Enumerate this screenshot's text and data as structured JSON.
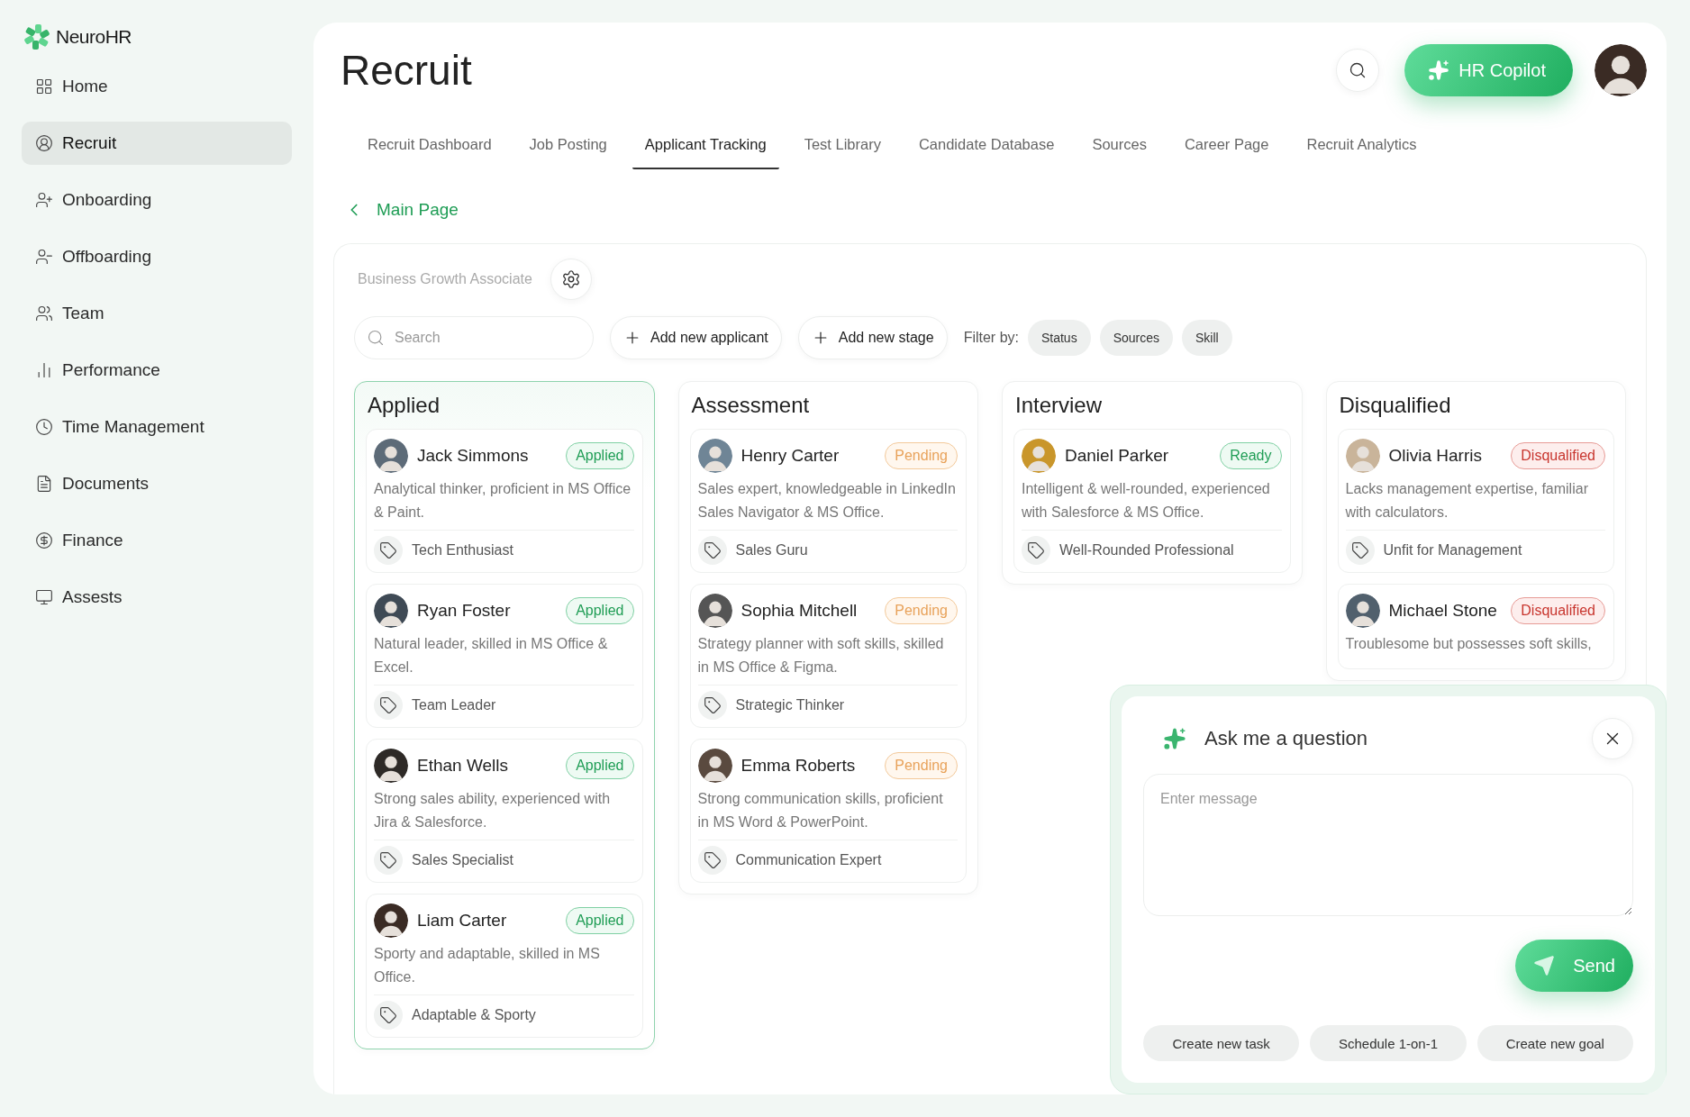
{
  "brand": "NeuroHR",
  "sidebar": {
    "items": [
      {
        "label": "Home",
        "selected": false
      },
      {
        "label": "Recruit",
        "selected": true
      },
      {
        "label": "Onboarding",
        "selected": false
      },
      {
        "label": "Offboarding",
        "selected": false
      },
      {
        "label": "Team",
        "selected": false
      },
      {
        "label": "Performance",
        "selected": false
      },
      {
        "label": "Time Management",
        "selected": false
      },
      {
        "label": "Documents",
        "selected": false
      },
      {
        "label": "Finance",
        "selected": false
      },
      {
        "label": "Assests",
        "selected": false
      }
    ]
  },
  "page": {
    "title": "Recruit",
    "copilot": "HR Copilot"
  },
  "tabs": [
    {
      "label": "Recruit Dashboard",
      "selected": false
    },
    {
      "label": "Job Posting",
      "selected": false
    },
    {
      "label": "Applicant Tracking",
      "selected": true
    },
    {
      "label": "Test Library",
      "selected": false
    },
    {
      "label": "Candidate Database",
      "selected": false
    },
    {
      "label": "Sources",
      "selected": false
    },
    {
      "label": "Career Page",
      "selected": false
    },
    {
      "label": "Recruit Analytics",
      "selected": false
    }
  ],
  "breadcrumb": "Main Page",
  "board": {
    "job_title": "Business Growth Associate",
    "search": {
      "placeholder": "Search"
    },
    "buttons": [
      "Add new applicant",
      "Add new stage"
    ],
    "filter_label": "Filter by:",
    "filters": [
      "Status",
      "Sources",
      "Skill"
    ],
    "columns": [
      {
        "title": "Applied",
        "selected": true,
        "cards": [
          {
            "name": "Jack Simmons",
            "status": {
              "label": "Applied",
              "kind": "applied"
            },
            "description": "Analytical thinker, proficient in MS Office & Paint.",
            "tag": "Tech Enthusiast"
          },
          {
            "name": "Ryan Foster",
            "status": {
              "label": "Applied",
              "kind": "applied"
            },
            "description": "Natural leader, skilled in MS Office & Excel.",
            "tag": "Team Leader"
          },
          {
            "name": "Ethan Wells",
            "status": {
              "label": "Applied",
              "kind": "applied"
            },
            "description": "Strong sales ability, experienced with Jira & Salesforce.",
            "tag": "Sales Specialist"
          },
          {
            "name": "Liam Carter",
            "status": {
              "label": "Applied",
              "kind": "applied"
            },
            "description": "Sporty and adaptable, skilled in MS Office.",
            "tag": "Adaptable & Sporty"
          }
        ]
      },
      {
        "title": "Assessment",
        "selected": false,
        "cards": [
          {
            "name": "Henry Carter",
            "status": {
              "label": "Pending",
              "kind": "pending"
            },
            "description": "Sales expert, knowledgeable in LinkedIn Sales Navigator & MS Office.",
            "tag": "Sales Guru"
          },
          {
            "name": "Sophia Mitchell",
            "status": {
              "label": "Pending",
              "kind": "pending"
            },
            "description": "Strategy planner with soft skills, skilled in MS Office & Figma.",
            "tag": "Strategic Thinker"
          },
          {
            "name": "Emma Roberts",
            "status": {
              "label": "Pending",
              "kind": "pending"
            },
            "description": "Strong communication skills, proficient in MS Word & PowerPoint.",
            "tag": "Communication Expert"
          }
        ]
      },
      {
        "title": "Interview",
        "selected": false,
        "cards": [
          {
            "name": "Daniel Parker",
            "status": {
              "label": "Ready",
              "kind": "ready"
            },
            "description": "Intelligent & well-rounded, experienced with Salesforce & MS Office.",
            "tag": "Well-Rounded Professional"
          }
        ]
      },
      {
        "title": "Disqualified",
        "selected": false,
        "cards": [
          {
            "name": "Olivia Harris",
            "status": {
              "label": "Disqualified",
              "kind": "disqualified"
            },
            "description": "Lacks management expertise, familiar with calculators.",
            "tag": "Unfit for Management"
          },
          {
            "name": "Michael Stone",
            "status": {
              "label": "Disqualified",
              "kind": "disqualified"
            },
            "description": "Troublesome but possesses soft skills,"
          }
        ]
      }
    ]
  },
  "chat": {
    "title": "Ask me a question",
    "message": {
      "placeholder": "Enter message"
    },
    "send": "Send",
    "suggestions": [
      "Create new task",
      "Schedule 1-on-1",
      "Create new goal"
    ]
  }
}
